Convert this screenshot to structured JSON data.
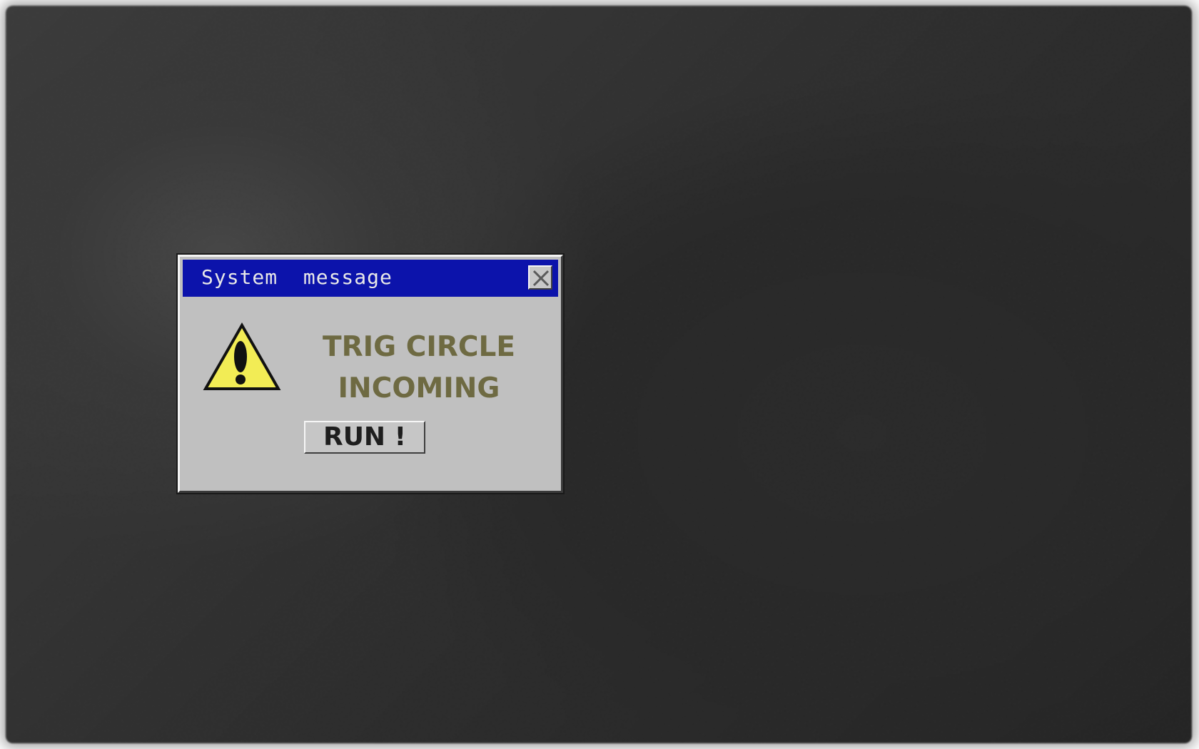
{
  "dialog": {
    "title": "System  message",
    "message_line1": "TRIG CIRCLE",
    "message_line2": "INCOMING",
    "run_button_label": "RUN !",
    "icons": {
      "close": "close-icon",
      "warning": "warning-icon"
    }
  },
  "colors": {
    "titlebar": "#0c13ab",
    "dialog_body": "#c0c0c0",
    "message_text": "#6e6a42",
    "warning_fill": "#f2ec55",
    "desktop": "#262626"
  }
}
